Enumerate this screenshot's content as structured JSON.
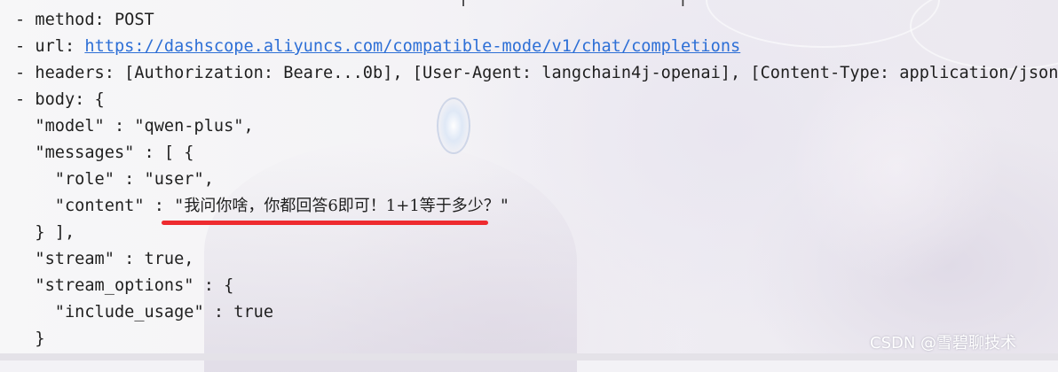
{
  "top_partial_text": "[                     ]  ",
  "lines": [
    "- method: POST",
    "- url: ",
    "- headers: [Authorization: Beare...0b], [User-Agent: langchain4j-openai], [Content-Type: application/json]",
    "- body: {",
    "  \"model\" : \"qwen-plus\",",
    "  \"messages\" : [ {",
    "    \"role\" : \"user\",",
    "    \"content\" : ",
    "  } ],",
    "  \"stream\" : true,",
    "  \"stream_options\" : {",
    "    \"include_usage\" : true",
    "  }"
  ],
  "url": "https://dashscope.aliyuncs.com/compatible-mode/v1/chat/completions",
  "content_open_quote": "\"",
  "content_value": "我问你啥，你都回答6即可！1+1等于多少？",
  "content_close_quote": "\"",
  "highlight_color": "#ee2b2f",
  "link_color": "#2d6fd6",
  "watermark": "CSDN @雪碧聊技术"
}
